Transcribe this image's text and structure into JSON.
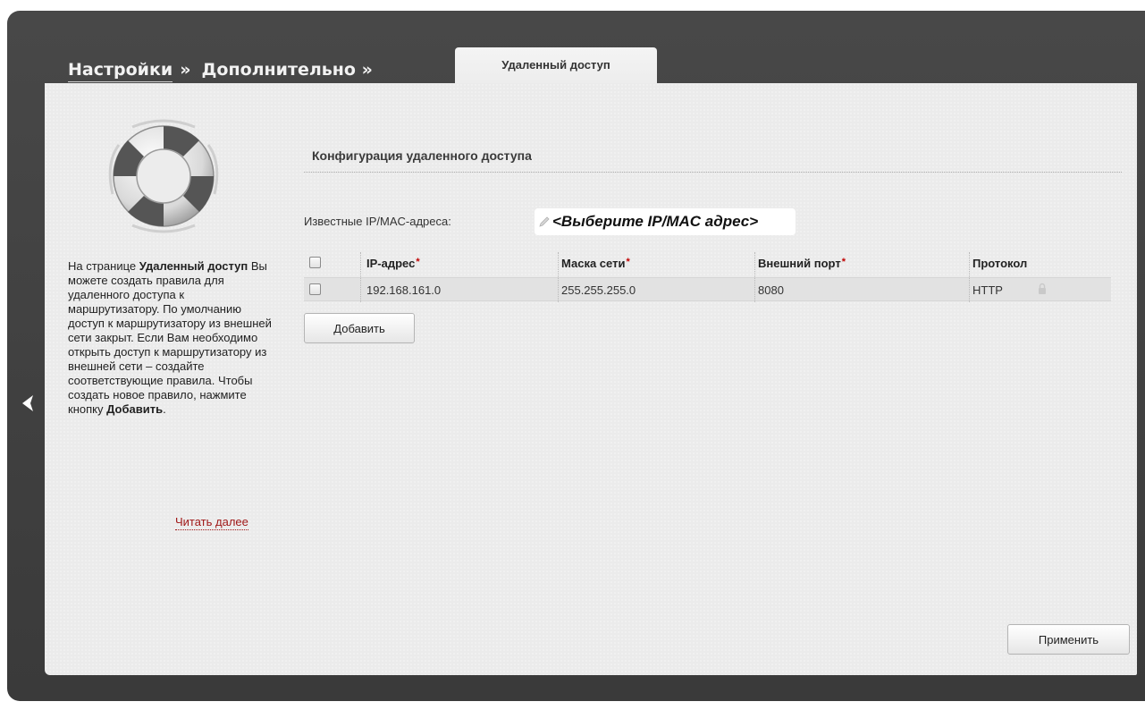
{
  "breadcrumb": {
    "settings": "Настройки",
    "sep1": "»",
    "advanced": "Дополнительно »",
    "active_tab": "Удаленный доступ"
  },
  "help": {
    "text_intro": "На странице ",
    "text_bold_page": "Удаленный доступ",
    "text_body": " Вы можете создать правила для удаленного доступа к маршрутизатору. По умолчанию доступ к маршрутизатору из внешней сети закрыт. Если Вам необходимо открыть доступ к маршрутизатору из внешней сети – создайте соответствующие правила. Чтобы создать новое правило, нажмите кнопку ",
    "text_bold_button": "Добавить",
    "text_end": ".",
    "read_more": "Читать далее"
  },
  "section": {
    "title": "Конфигурация удаленного доступа"
  },
  "known_addresses": {
    "label": "Известные IP/MAC-адреса:",
    "value": "<Выберите IP/MAC адрес>"
  },
  "table": {
    "headers": {
      "ip": "IP-адрес",
      "mask": "Маска сети",
      "port": "Внешний порт",
      "protocol": "Протокол"
    },
    "required_mark": "*",
    "rows": [
      {
        "ip": "192.168.161.0",
        "mask": "255.255.255.0",
        "port": "8080",
        "protocol": "HTTP"
      }
    ]
  },
  "buttons": {
    "add": "Добавить",
    "apply": "Применить"
  },
  "icons": {
    "back": "chevron-left-icon",
    "help_image": "lifebuoy-icon",
    "select_edit": "pencil-icon",
    "row_lock": "lock-icon"
  },
  "colors": {
    "frame": "#3b3b3b",
    "panel": "#ebebeb",
    "link": "#a01818",
    "required": "#c00000"
  }
}
